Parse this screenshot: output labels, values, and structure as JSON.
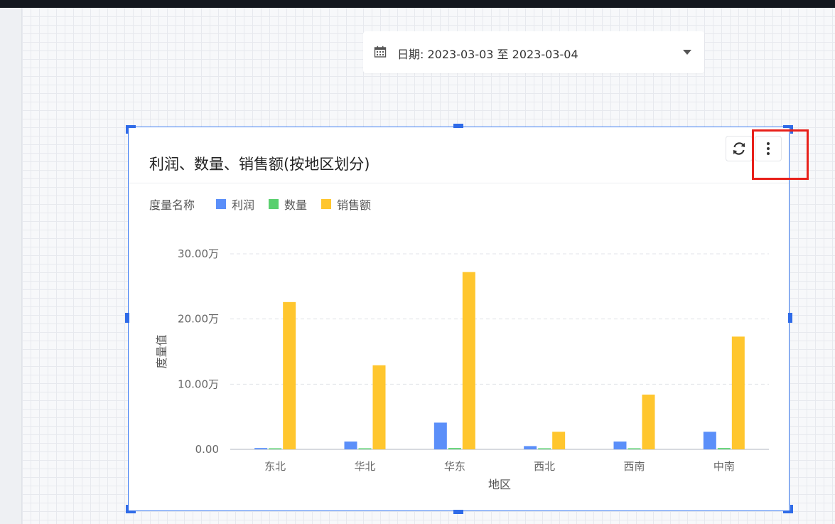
{
  "date_filter": {
    "text": "日期: 2023-03-03 至 2023-03-04"
  },
  "card": {
    "title": "利润、数量、销售额(按地区划分)",
    "refresh_icon": "refresh-icon",
    "more_icon": "more-vertical-icon"
  },
  "colors": {
    "profit": "#5b8ff9",
    "quantity": "#5ad06f",
    "sales": "#ffc62e",
    "grid": "#e0e3e8",
    "axis": "#bfc4cc"
  },
  "chart_data": {
    "type": "bar",
    "legend_title": "度量名称",
    "legend_position": "top-left",
    "categories": [
      "东北",
      "华北",
      "华东",
      "西北",
      "西南",
      "中南"
    ],
    "series": [
      {
        "name": "利润",
        "values": [
          0.2,
          1.2,
          4.1,
          0.5,
          1.2,
          2.7
        ]
      },
      {
        "name": "数量",
        "values": [
          0.1,
          0.1,
          0.2,
          0.1,
          0.1,
          0.2
        ]
      },
      {
        "name": "销售额",
        "values": [
          22.6,
          12.9,
          27.2,
          2.7,
          8.4,
          17.3
        ]
      }
    ],
    "y_ticks": [
      "0.00",
      "10.00万",
      "20.00万",
      "30.00万"
    ],
    "ylim": [
      0,
      30
    ],
    "xlabel": "地区",
    "ylabel": "度量值",
    "grid": true
  }
}
